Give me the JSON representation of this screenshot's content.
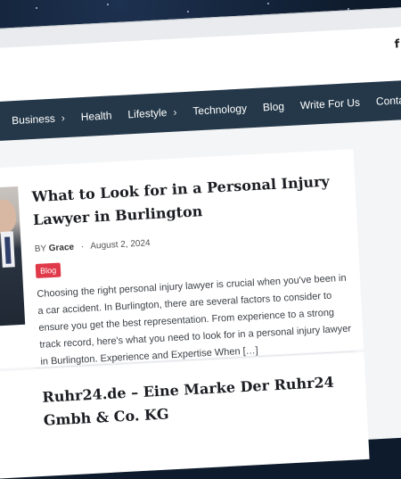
{
  "social": {
    "facebook_glyph": "f"
  },
  "nav": {
    "items": [
      {
        "label": "",
        "chevron": "›"
      },
      {
        "label": "Business",
        "chevron": "›"
      },
      {
        "label": "Health",
        "chevron": ""
      },
      {
        "label": "Lifestyle",
        "chevron": "›"
      },
      {
        "label": "Technology",
        "chevron": ""
      },
      {
        "label": "Blog",
        "chevron": ""
      },
      {
        "label": "Write For Us",
        "chevron": ""
      },
      {
        "label": "Contact",
        "chevron": ""
      }
    ]
  },
  "posts": [
    {
      "title": "What to Look for in a Personal Injury Lawyer in Burlington",
      "by": "BY",
      "author": "Grace",
      "separator": "·",
      "date": "August 2, 2024",
      "category": "Blog",
      "excerpt": "Choosing the right personal injury lawyer is crucial when you've been in a car accident. In Burlington, there are several factors to consider to ensure you get the best representation. From experience to a strong track record, here's what you need to look for in a personal injury lawyer in Burlington. Experience and Expertise When […]"
    },
    {
      "title": "Ruhr24.de – Eine Marke Der Ruhr24 Gmbh & Co. KG"
    }
  ]
}
